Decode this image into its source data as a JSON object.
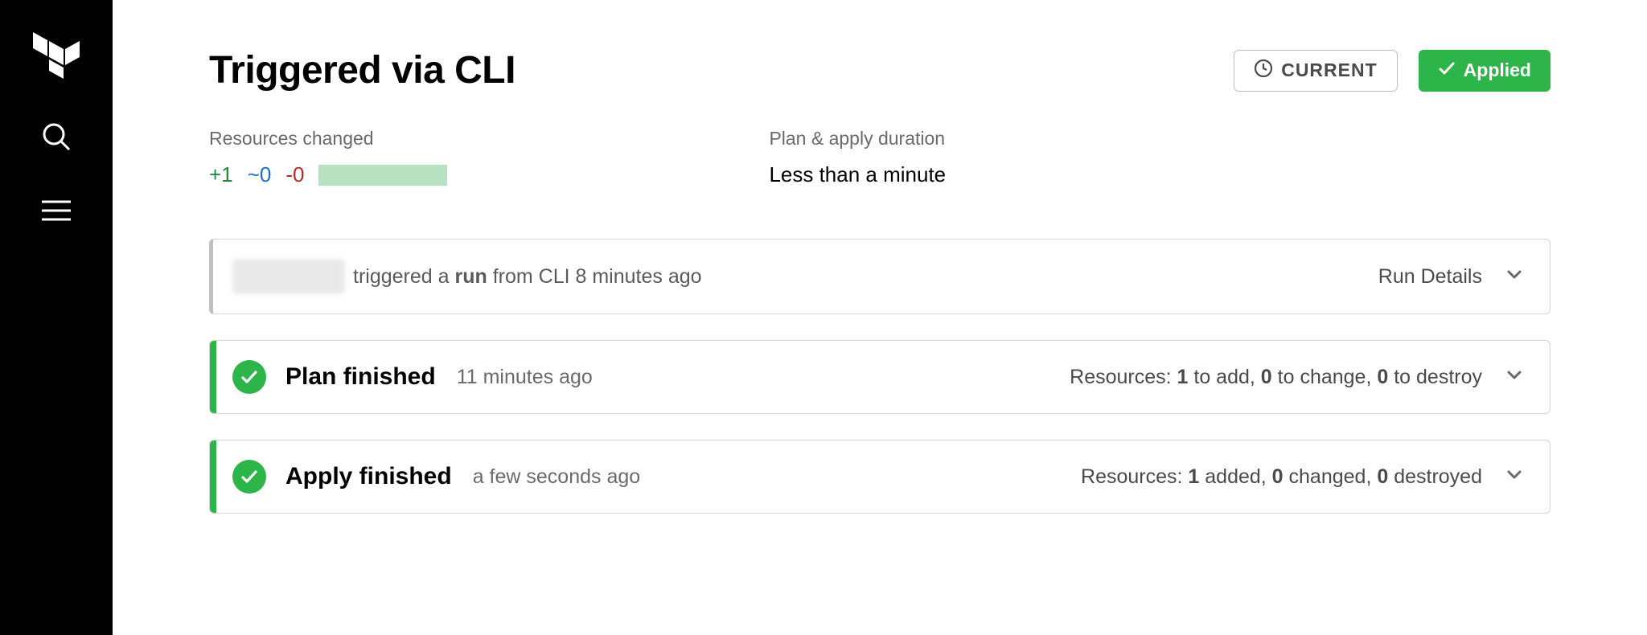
{
  "header": {
    "title": "Triggered via CLI",
    "badges": {
      "current": "CURRENT",
      "applied": "Applied"
    }
  },
  "summary": {
    "resources_label": "Resources changed",
    "add": "+1",
    "mod": "~0",
    "del": "-0",
    "duration_label": "Plan & apply duration",
    "duration_value": "Less than a minute"
  },
  "trigger_card": {
    "text_prefix": " triggered a ",
    "text_bold": "run",
    "text_suffix": " from CLI 8 minutes ago",
    "details_label": "Run Details"
  },
  "plan_card": {
    "title": "Plan finished",
    "time": "11 minutes ago",
    "res_prefix": "Resources: ",
    "n_add": "1",
    "t_add": " to add, ",
    "n_change": "0",
    "t_change": " to change, ",
    "n_destroy": "0",
    "t_destroy": " to destroy"
  },
  "apply_card": {
    "title": "Apply finished",
    "time": "a few seconds ago",
    "res_prefix": "Resources: ",
    "n_add": "1",
    "t_add": " added, ",
    "n_change": "0",
    "t_change": " changed, ",
    "n_destroy": "0",
    "t_destroy": " destroyed"
  }
}
